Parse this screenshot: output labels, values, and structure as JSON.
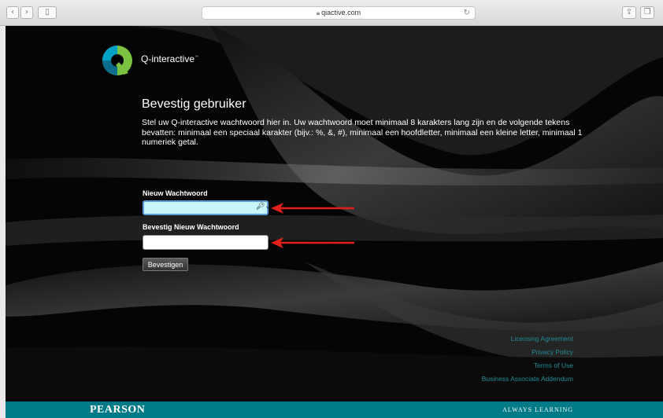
{
  "browser": {
    "url": "qiactive.com",
    "back_icon": "chevron-left-icon",
    "forward_icon": "chevron-right-icon",
    "sidebar_icon": "sidebar-icon",
    "reload_icon": "reload-icon",
    "share_icon": "share-icon",
    "tabs_icon": "tabs-icon"
  },
  "header": {
    "brand": "Q-interactive",
    "trademark": "™"
  },
  "main": {
    "title": "Bevestig gebruiker",
    "description": "Stel uw Q-interactive wachtwoord hier in. Uw wachtwoord moet minimaal 8 karakters lang zijn en de volgende tekens bevatten: minimaal een speciaal karakter (bijv.: %, &, #), minimaal een hoofdletter, minimaal een kleine letter, minimaal 1 numeriek getal."
  },
  "form": {
    "new_password_label": "Nieuw Wachtwoord",
    "new_password_value": "",
    "confirm_password_label": "Bevestig Nieuw Wachtwoord",
    "confirm_password_value": "",
    "submit_label": "Bevestigen"
  },
  "footer": {
    "links": [
      "Licensing Agreement",
      "Privacy Policy",
      "Terms of Use",
      "Business Associate Addendum"
    ],
    "company": "PEARSON",
    "tagline": "ALWAYS LEARNING"
  },
  "colors": {
    "accent_teal": "#007a87",
    "link_teal": "#1e8c96",
    "annotation_arrow": "#e0201b",
    "active_input": "#c9f6fb"
  }
}
